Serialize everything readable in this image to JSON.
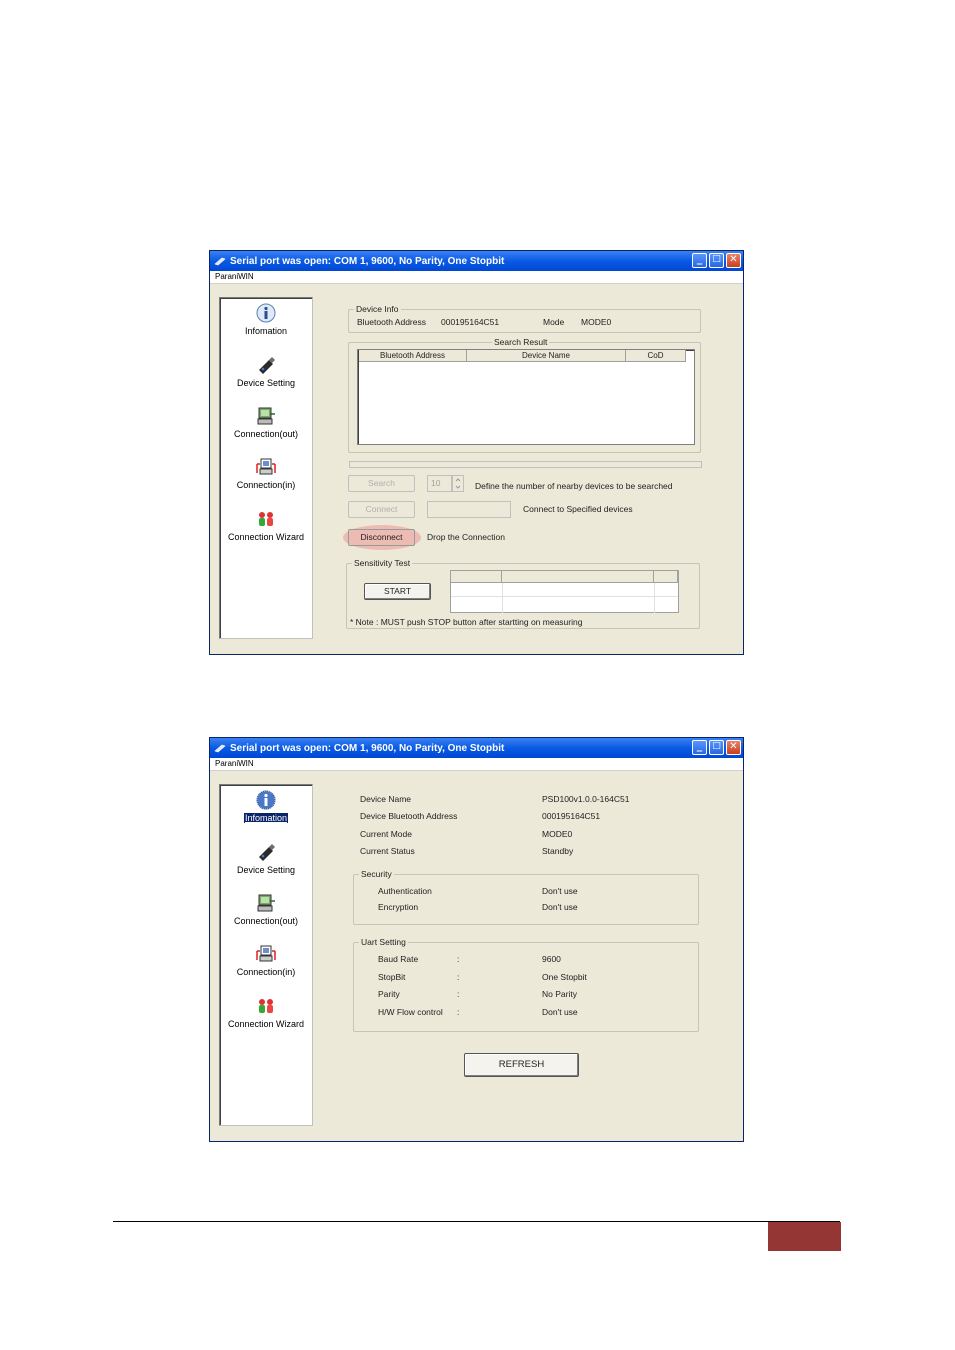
{
  "window1": {
    "title": "Serial port was open: COM 1, 9600, No Parity, One Stopbit",
    "menu": "ParaniWIN",
    "sidebar": [
      {
        "label": "Infomation",
        "icon": "info-icon"
      },
      {
        "label": "Device Setting",
        "icon": "bluetooth-dongle-icon"
      },
      {
        "label": "Connection(out)",
        "icon": "computer-out-icon"
      },
      {
        "label": "Connection(in)",
        "icon": "computer-in-icon"
      },
      {
        "label": "Connection Wizard",
        "icon": "people-wizard-icon"
      }
    ],
    "device_info": {
      "legend": "Device Info",
      "bt_address_label": "Bluetooth Address",
      "bt_address_value": "000195164C51",
      "mode_label": "Mode",
      "mode_value": "MODE0"
    },
    "search_result": {
      "legend": "Search Result",
      "columns": [
        "Bluetooth Address",
        "Device Name",
        "CoD"
      ]
    },
    "search_button": "Search",
    "search_count": "10",
    "search_desc": "Define the number of nearby devices to be searched",
    "connect_button": "Connect",
    "connect_desc": "Connect to Specified devices",
    "disconnect_button": "Disconnect",
    "disconnect_desc": "Drop the Connection",
    "sensitivity": {
      "legend": "Sensitivity Test",
      "start_button": "START",
      "note": "* Note : MUST push STOP button after startting on measuring"
    }
  },
  "window2": {
    "title": "Serial port was open: COM 1, 9600, No Parity, One Stopbit",
    "menu": "ParaniWIN",
    "sidebar": [
      {
        "label": "Infomation",
        "icon": "info-icon"
      },
      {
        "label": "Device Setting",
        "icon": "bluetooth-dongle-icon"
      },
      {
        "label": "Connection(out)",
        "icon": "computer-out-icon"
      },
      {
        "label": "Connection(in)",
        "icon": "computer-in-icon"
      },
      {
        "label": "Connection Wizard",
        "icon": "people-wizard-icon"
      }
    ],
    "info": [
      {
        "label": "Device Name",
        "value": "PSD100v1.0.0-164C51"
      },
      {
        "label": "Device Bluetooth Address",
        "value": "000195164C51"
      },
      {
        "label": "Current Mode",
        "value": "MODE0"
      },
      {
        "label": "Current Status",
        "value": "Standby"
      }
    ],
    "security": {
      "legend": "Security",
      "rows": [
        {
          "label": "Authentication",
          "value": "Don't use"
        },
        {
          "label": "Encryption",
          "value": "Don't use"
        }
      ]
    },
    "uart": {
      "legend": "Uart Setting",
      "separator": ":",
      "rows": [
        {
          "label": "Baud Rate",
          "value": "9600"
        },
        {
          "label": "StopBit",
          "value": "One Stopbit"
        },
        {
          "label": "Parity",
          "value": "No Parity"
        },
        {
          "label": "H/W Flow control",
          "value": "Don't use"
        }
      ]
    },
    "refresh_button": "REFRESH"
  },
  "colors": {
    "titlebar": "#0a5ae3",
    "window_bg": "#ece9d8",
    "highlight": "#ec9696",
    "footer_box": "#943634"
  }
}
